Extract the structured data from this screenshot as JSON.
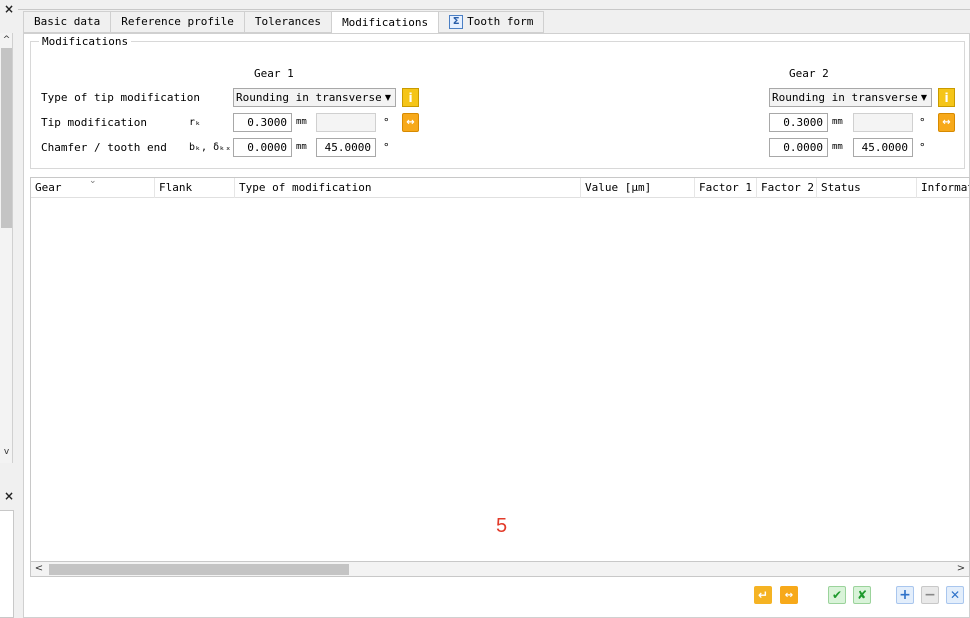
{
  "tabs": [
    {
      "label": "Basic data",
      "active": false
    },
    {
      "label": "Reference profile",
      "active": false
    },
    {
      "label": "Tolerances",
      "active": false
    },
    {
      "label": "Modifications",
      "active": true
    },
    {
      "label": "Tooth form",
      "active": false,
      "icon": "sigma-icon"
    }
  ],
  "modifications": {
    "group_title": "Modifications",
    "gear1_header": "Gear 1",
    "gear2_header": "Gear 2",
    "tip_type_label": "Type of tip modification",
    "tip_mod_label": "Tip modification",
    "tip_mod_symbol": "rₖ",
    "chamfer_label": "Chamfer / tooth end",
    "chamfer_symbol": "bₖ, δₖₓ",
    "gear1": {
      "tip_type": "Rounding in transverse :",
      "tip_value": "0.3000",
      "tip_unit": "mm",
      "tip_angle": "",
      "tip_angle_unit": "°",
      "chamfer_value": "0.0000",
      "chamfer_unit": "mm",
      "chamfer_angle": "45.0000",
      "chamfer_angle_unit": "°"
    },
    "gear2": {
      "tip_type": "Rounding in transverse :",
      "tip_value": "0.3000",
      "tip_unit": "mm",
      "tip_angle": "",
      "tip_angle_unit": "°",
      "chamfer_value": "0.0000",
      "chamfer_unit": "mm",
      "chamfer_angle": "45.0000",
      "chamfer_angle_unit": "°"
    }
  },
  "table": {
    "columns": [
      "Gear",
      "Flank",
      "Type of modification",
      "Value [μm]",
      "Factor 1",
      "Factor 2",
      "Status",
      "Informat"
    ],
    "rows": []
  },
  "marker_text": "5",
  "icons": {
    "close": "×",
    "scroll_up": "^",
    "scroll_down": "v",
    "scroll_left": "<",
    "scroll_right": ">",
    "info": "i",
    "sync": "↔",
    "accept": "↵",
    "ok": "✔",
    "cancel": "✘",
    "add": "+",
    "remove": "−",
    "clear": "✕"
  }
}
